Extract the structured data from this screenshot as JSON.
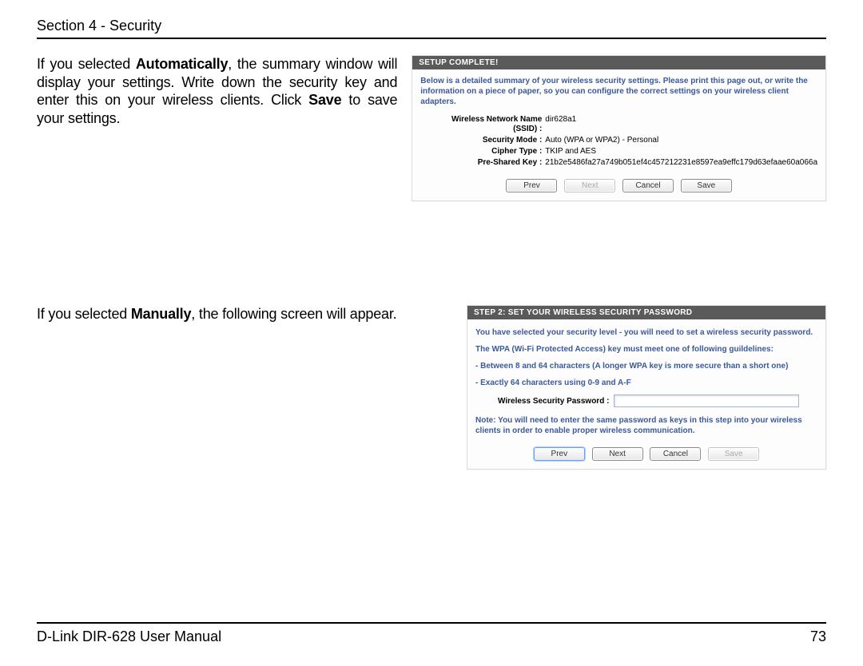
{
  "header": {
    "section": "Section 4 - Security"
  },
  "para1": {
    "pre": "If you selected ",
    "b": "Automatically",
    "post": ", the summary window will display your settings. Write down the security key and enter this on your wireless clients. Click ",
    "b2": "Save",
    "post2": " to save your settings."
  },
  "panel1": {
    "title": "SETUP COMPLETE!",
    "intro": "Below is a detailed summary of your wireless security settings. Please print this page out, or write the information on a piece of paper, so you can configure the correct settings on your wireless client adapters.",
    "rows": [
      {
        "label": "Wireless Network Name (SSID) :",
        "value": "dir628a1"
      },
      {
        "label": "Security Mode :",
        "value": "Auto (WPA or WPA2) - Personal"
      },
      {
        "label": "Cipher Type :",
        "value": "TKIP and AES"
      },
      {
        "label": "Pre-Shared Key :",
        "value": "21b2e5486fa27a749b051ef4c457212231e8597ea9effc179d63efaae60a066a"
      }
    ],
    "buttons": {
      "prev": "Prev",
      "next": "Next",
      "cancel": "Cancel",
      "save": "Save"
    }
  },
  "para2": {
    "pre": "If you selected ",
    "b": "Manually",
    "post": ", the following screen will appear."
  },
  "panel2": {
    "title": "STEP 2: SET YOUR WIRELESS SECURITY PASSWORD",
    "line1": "You have selected your security level - you will need to set a wireless security password.",
    "line2": "The WPA (Wi-Fi Protected Access) key must meet one of following guildelines:",
    "bullet1": "- Between 8 and 64 characters (A longer WPA key is more secure than a short one)",
    "bullet2": "- Exactly 64 characters using 0-9 and A-F",
    "inputLabel": "Wireless Security Password :",
    "note": "Note: You will need to enter the same password as keys in this step into your wireless clients in order to enable proper wireless communication.",
    "buttons": {
      "prev": "Prev",
      "next": "Next",
      "cancel": "Cancel",
      "save": "Save"
    }
  },
  "footer": {
    "left": "D-Link DIR-628 User Manual",
    "right": "73"
  }
}
